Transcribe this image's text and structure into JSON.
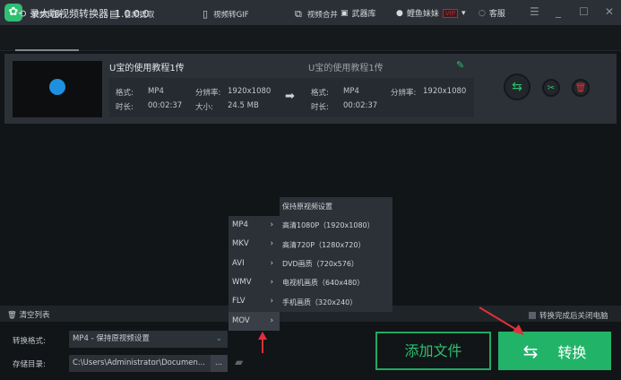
{
  "app": {
    "title": "录大咖视频转换器",
    "version": "1.0.0.0"
  },
  "titlebar": {
    "arsenal": "武器库",
    "user": "鲤鱼妹妹",
    "vip": "VIP",
    "support": "客服"
  },
  "tabs": [
    {
      "label": "视频转换"
    },
    {
      "label": "音频提取"
    },
    {
      "label": "视频转GIF"
    },
    {
      "label": "视频合并"
    }
  ],
  "file": {
    "name": "U宝的使用教程1传",
    "output_name": "U宝的使用教程1传",
    "src": {
      "format_label": "格式:",
      "format": "MP4",
      "res_label": "分辨率:",
      "res": "1920x1080",
      "dur_label": "时长:",
      "dur": "00:02:37",
      "size_label": "大小:",
      "size": "24.5 MB"
    },
    "dst": {
      "format_label": "格式:",
      "format": "MP4",
      "res_label": "分辨率:",
      "res": "1920x1080",
      "dur_label": "时长:",
      "dur": "00:02:37"
    }
  },
  "format_menu": [
    "MP4",
    "MKV",
    "AVI",
    "WMV",
    "FLV",
    "MOV"
  ],
  "preset_menu": [
    "保持原视频设置",
    "高清1080P（1920x1080）",
    "高清720P（1280x720）",
    "DVD画质（720x576）",
    "电视机画质（640x480）",
    "手机画质（320x240）"
  ],
  "bottom": {
    "clear": "清空列表",
    "shutdown": "转换完成后关闭电脑",
    "format_label": "转换格式:",
    "format_value": "MP4 - 保持原视频设置",
    "dir_label": "存储目录:",
    "dir_value": "C:\\Users\\Administrator\\Documen...",
    "browse": "...",
    "add_file": "添加文件",
    "convert": "转换"
  }
}
